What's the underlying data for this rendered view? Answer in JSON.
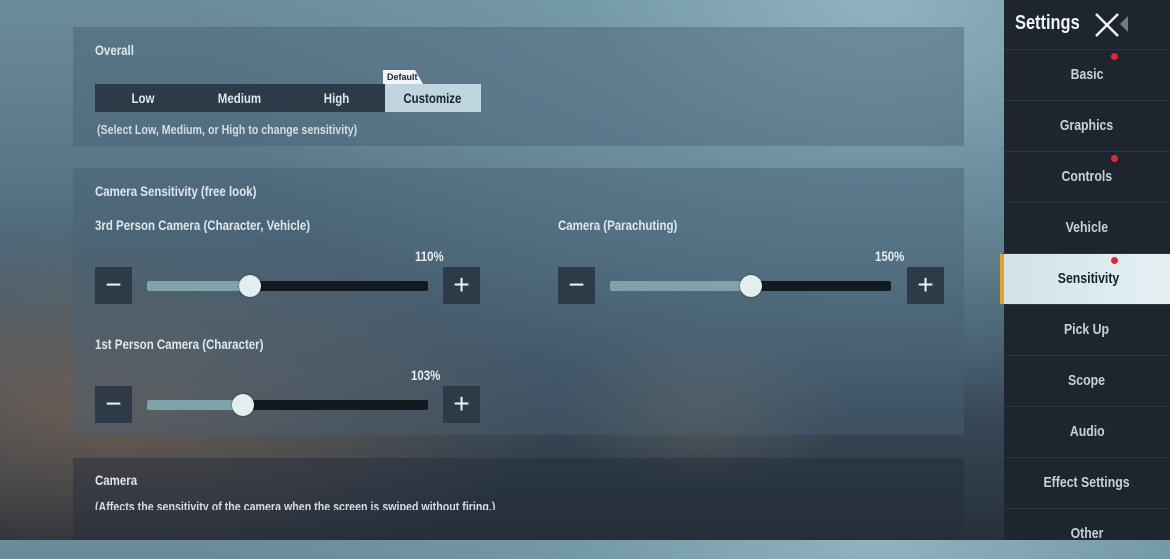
{
  "sidebar": {
    "title": "Settings",
    "items": [
      {
        "label": "Basic",
        "badge": true
      },
      {
        "label": "Graphics",
        "badge": false
      },
      {
        "label": "Controls",
        "badge": true
      },
      {
        "label": "Vehicle",
        "badge": false
      },
      {
        "label": "Sensitivity",
        "badge": true,
        "active": true
      },
      {
        "label": "Pick Up",
        "badge": false
      },
      {
        "label": "Scope",
        "badge": false
      },
      {
        "label": "Audio",
        "badge": false
      },
      {
        "label": "Effect Settings",
        "badge": false
      },
      {
        "label": "Other",
        "badge": false
      }
    ]
  },
  "overall": {
    "title": "Overall",
    "options": [
      "Low",
      "Medium",
      "High",
      "Customize"
    ],
    "selected": "Customize",
    "default_tag": "Default",
    "hint": "(Select Low, Medium, or High to change sensitivity)"
  },
  "camera_sensitivity": {
    "title": "Camera Sensitivity (free look)",
    "sliders": [
      {
        "label": "3rd Person Camera (Character, Vehicle)",
        "value_text": "110%",
        "value": 110,
        "min": 0,
        "max": 300
      },
      {
        "label": "Camera (Parachuting)",
        "value_text": "150%",
        "value": 150,
        "min": 0,
        "max": 300
      },
      {
        "label": "1st Person Camera (Character)",
        "value_text": "103%",
        "value": 103,
        "min": 0,
        "max": 300
      }
    ],
    "minus_symbol": "−",
    "plus_symbol": "+"
  },
  "camera": {
    "title": "Camera",
    "description": "(Affects the sensitivity of the camera when the screen is swiped without firing.)"
  },
  "colors": {
    "accent": "#e0a526",
    "badge": "#e0263a",
    "active_tab": "#d0e3e8"
  }
}
